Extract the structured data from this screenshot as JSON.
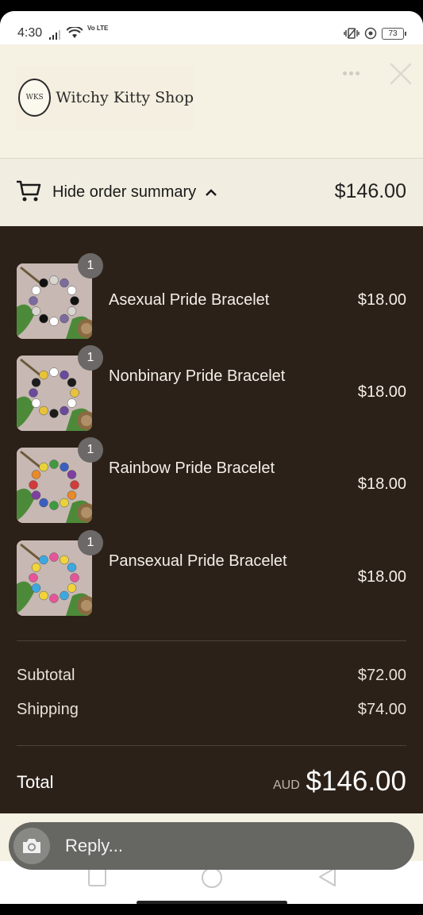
{
  "status_bar": {
    "time": "4:30",
    "network": "Vo LTE",
    "battery": "73"
  },
  "header": {
    "logo_initials": "WKS",
    "shop_name": "Witchy Kitty Shop"
  },
  "summary_toggle": {
    "label": "Hide order summary",
    "total": "$146.00"
  },
  "items": [
    {
      "name": "Asexual Pride Bracelet",
      "price": "$18.00",
      "quantity": "1",
      "bead_colors": [
        "#111111",
        "#d9d6d2",
        "#7b6b9e",
        "#ffffff"
      ]
    },
    {
      "name": "Nonbinary Pride Bracelet",
      "price": "$18.00",
      "quantity": "1",
      "bead_colors": [
        "#e8c23a",
        "#ffffff",
        "#6a4a9c",
        "#1c1c1c"
      ]
    },
    {
      "name": "Rainbow Pride Bracelet",
      "price": "$18.00",
      "quantity": "1",
      "bead_colors": [
        "#d23b3b",
        "#e8892a",
        "#e8d23a",
        "#3f9a3f",
        "#3a5fbf",
        "#7d3fa0"
      ]
    },
    {
      "name": "Pansexual Pride Bracelet",
      "price": "$18.00",
      "quantity": "1",
      "bead_colors": [
        "#e6559a",
        "#f1d33c",
        "#3da8e0"
      ]
    }
  ],
  "totals": {
    "subtotal_label": "Subtotal",
    "subtotal_value": "$72.00",
    "shipping_label": "Shipping",
    "shipping_value": "$74.00",
    "total_label": "Total",
    "currency": "AUD",
    "total_value": "$146.00"
  },
  "reply": {
    "placeholder": "Reply..."
  },
  "colors": {
    "header_bg": "#f5f1e3",
    "summary_bg": "#2c2119",
    "reply_bg": "#666662"
  }
}
